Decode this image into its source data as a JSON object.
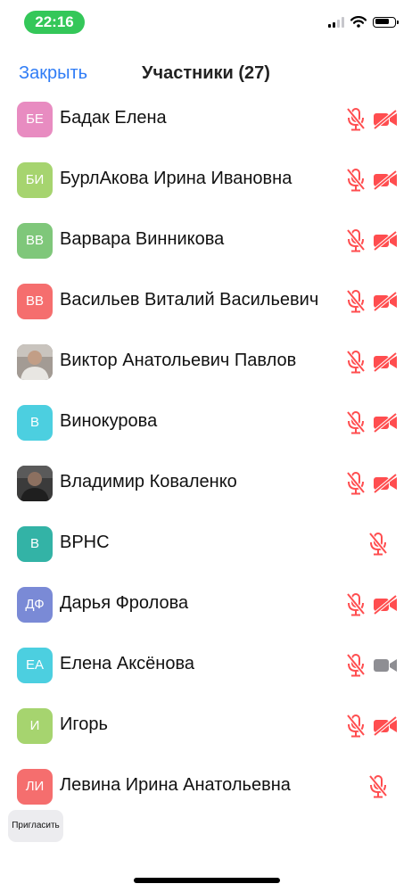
{
  "status_bar": {
    "time": "22:16",
    "time_pill_color": "#34c759"
  },
  "nav": {
    "close_label": "Закрыть",
    "title": "Участники (27)"
  },
  "colors": {
    "muted_red": "#ff4d4f",
    "accent_blue": "#2f7cf6",
    "camera_on_gray": "#8e8e93"
  },
  "participants": [
    {
      "name": "Бадак Елена",
      "initials": "БЕ",
      "avatar_color": "#e88cc1",
      "mic": "muted",
      "video": "off"
    },
    {
      "name": "БурлАкова Ирина Ивановна",
      "initials": "БИ",
      "avatar_color": "#a6d46f",
      "mic": "muted",
      "video": "off"
    },
    {
      "name": "Варвара Винникова",
      "initials": "ВВ",
      "avatar_color": "#7fc77a",
      "mic": "muted",
      "video": "off"
    },
    {
      "name": "Васильев Виталий Васильевич",
      "initials": "ВВ",
      "avatar_color": "#f56e6e",
      "mic": "muted",
      "video": "off"
    },
    {
      "name": "Виктор Анатольевич Павлов",
      "initials": "",
      "avatar_type": "photo",
      "mic": "muted",
      "video": "off"
    },
    {
      "name": "Винокурова",
      "initials": "В",
      "avatar_color": "#4ccfe0",
      "mic": "muted",
      "video": "off"
    },
    {
      "name": "Владимир Коваленко",
      "initials": "",
      "avatar_type": "photo-dark",
      "mic": "muted",
      "video": "off"
    },
    {
      "name": "ВРНС",
      "initials": "В",
      "avatar_color": "#33b3a6",
      "mic": "muted",
      "video": "none"
    },
    {
      "name": "Дарья Фролова",
      "initials": "ДФ",
      "avatar_color": "#7a8ad6",
      "mic": "muted",
      "video": "off"
    },
    {
      "name": "Елена Аксёнова",
      "initials": "ЕА",
      "avatar_color": "#4ccfe0",
      "mic": "muted",
      "video": "on"
    },
    {
      "name": "Игорь",
      "initials": "И",
      "avatar_color": "#a6d46f",
      "mic": "muted",
      "video": "off"
    },
    {
      "name": "Левина Ирина Анатольевна",
      "initials": "ЛИ",
      "avatar_color": "#f56e6e",
      "mic": "muted",
      "video": "none"
    }
  ],
  "footer": {
    "invite_label": "Пригласить"
  }
}
